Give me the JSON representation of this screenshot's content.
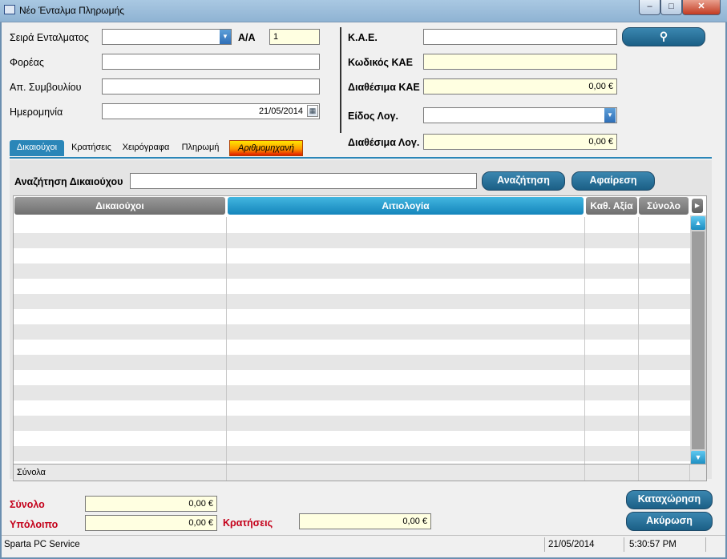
{
  "window": {
    "title": "Νέο Ένταλμα Πληρωμής",
    "min": "–",
    "max": "□",
    "close": "✕"
  },
  "form_left": {
    "seira_label": "Σειρά Ενταλματος",
    "seira_value": "",
    "aa_label": "Α/Α",
    "aa_value": "1",
    "foreas_label": "Φορέας",
    "foreas_value": "",
    "ap_symvouliou_label": "Απ. Συμβουλίου",
    "ap_symvouliou_value": "",
    "imerominia_label": "Ημερομηνία",
    "imerominia_value": "21/05/2014"
  },
  "form_right": {
    "kae_label": "Κ.Α.Ε.",
    "kae_value": "",
    "kodikos_kae_label": "Κωδικός ΚΑΕ",
    "kodikos_kae_value": "",
    "diathesima_kae_label": "Διαθέσιμα ΚΑΕ",
    "diathesima_kae_value": "0,00 €",
    "eidos_log_label": "Είδος Λογ.",
    "eidos_log_value": "",
    "diathesima_log_label": "Διαθέσιμα Λογ.",
    "diathesima_log_value": "0,00 €"
  },
  "tabs": [
    "Δικαιούχοι",
    "Κρατήσεις",
    "Χειρόγραφα",
    "Πληρωμή",
    "Αριθμομηχανή"
  ],
  "search": {
    "label": "Αναζήτηση Δικαιούχου",
    "value": "",
    "search_button": "Αναζήτηση",
    "remove_button": "Αφαίρεση"
  },
  "grid": {
    "columns": [
      "Δικαιούχοι",
      "Αιτιολογία",
      "Καθ. Αξία",
      "Σύνολο"
    ],
    "rows": [],
    "footer_label": "Σύνολα"
  },
  "totals": {
    "synolo_label": "Σύνολο",
    "synolo_value": "0,00 €",
    "ypoloipo_label": "Υπόλοιπο",
    "ypoloipo_value": "0,00 €",
    "kratiseis_label": "Κρατήσεις",
    "kratiseis_value": "0,00 €"
  },
  "actions": {
    "save": "Καταχώρηση",
    "cancel": "Ακύρωση"
  },
  "statusbar": {
    "company": "Sparta PC Service",
    "date": "21/05/2014",
    "time": "5:30:57 PM"
  },
  "colors": {
    "accent_blue": "#2a86b8",
    "input_yellow": "#ffffe1",
    "totals_red": "#c4001a"
  }
}
